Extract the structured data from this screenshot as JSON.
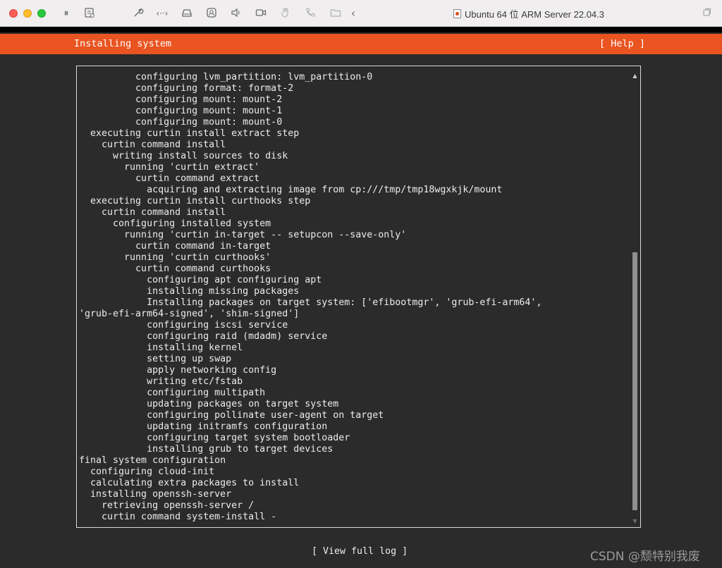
{
  "window": {
    "title": "Ubuntu 64 位 ARM Server 22.04.3",
    "toolbar_icons": [
      "pause-icon",
      "snapshot-icon",
      "wrench-icon",
      "code-icon",
      "disk-icon",
      "usb-icon",
      "volume-icon",
      "camera-icon",
      "hand-icon",
      "phone-icon",
      "folder-icon",
      "back-icon"
    ]
  },
  "installer": {
    "header_title": "Installing system",
    "help_label": "[ Help ]",
    "view_log_label": "[ View full log ]",
    "log_lines": [
      "          configuring lvm_partition: lvm_partition-0",
      "          configuring format: format-2",
      "          configuring mount: mount-2",
      "          configuring mount: mount-1",
      "          configuring mount: mount-0",
      "  executing curtin install extract step",
      "    curtin command install",
      "      writing install sources to disk",
      "        running 'curtin extract'",
      "          curtin command extract",
      "            acquiring and extracting image from cp:///tmp/tmp18wgxkjk/mount",
      "  executing curtin install curthooks step",
      "    curtin command install",
      "      configuring installed system",
      "        running 'curtin in-target -- setupcon --save-only'",
      "          curtin command in-target",
      "        running 'curtin curthooks'",
      "          curtin command curthooks",
      "            configuring apt configuring apt",
      "            installing missing packages",
      "            Installing packages on target system: ['efibootmgr', 'grub-efi-arm64',",
      "'grub-efi-arm64-signed', 'shim-signed']",
      "            configuring iscsi service",
      "            configuring raid (mdadm) service",
      "            installing kernel",
      "            setting up swap",
      "            apply networking config",
      "            writing etc/fstab",
      "            configuring multipath",
      "            updating packages on target system",
      "            configuring pollinate user-agent on target",
      "            updating initramfs configuration",
      "            configuring target system bootloader",
      "            installing grub to target devices",
      "final system configuration",
      "  configuring cloud-init",
      "  calculating extra packages to install",
      "  installing openssh-server",
      "    retrieving openssh-server /",
      "    curtin command system-install -"
    ]
  },
  "watermark": "CSDN @颓特别我废",
  "colors": {
    "accent": "#e95420",
    "screen_bg": "#2b2b2b",
    "text": "#ececec"
  }
}
